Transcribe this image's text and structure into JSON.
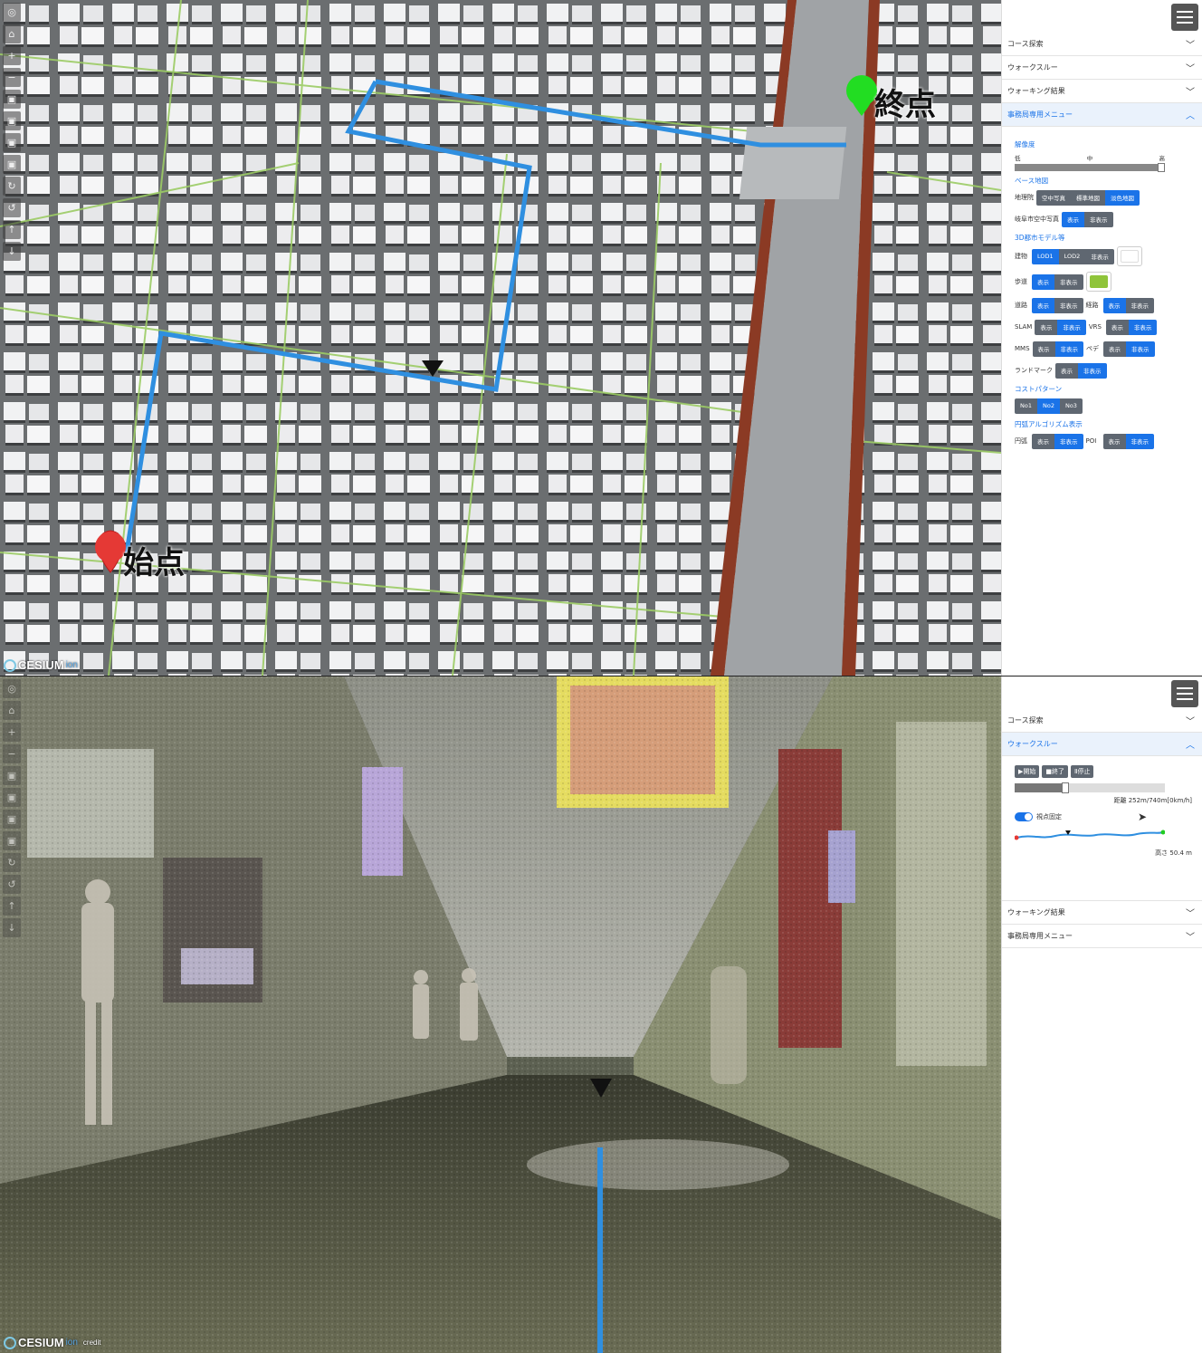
{
  "top_panel": {
    "start_label": "始点",
    "end_label": "終点",
    "logo": {
      "name": "CESIUM",
      "sub": "ion"
    },
    "toolbar_icons": [
      "compass-icon",
      "home-icon",
      "zoom-in-icon",
      "zoom-out-icon",
      "layer-icon",
      "layer-icon",
      "layer-icon",
      "layer-icon",
      "rotate-icon",
      "rotate-icon",
      "tilt-up-icon",
      "tilt-down-icon"
    ],
    "toolbar_glyphs": [
      "◎",
      "⌂",
      "+",
      "−",
      "▣",
      "▣",
      "▣",
      "▣",
      "↻",
      "↺",
      "↑",
      "↓"
    ],
    "side": {
      "accordion": [
        {
          "label": "コース探索",
          "open": false
        },
        {
          "label": "ウォークスルー",
          "open": false
        },
        {
          "label": "ウォーキング結果",
          "open": false
        },
        {
          "label": "事務局専用メニュー",
          "open": true
        }
      ],
      "resolution": {
        "title": "解像度",
        "low": "低",
        "mid": "中",
        "high": "高"
      },
      "base_map": {
        "title": "ベース地図",
        "gsi_label": "地理院",
        "gsi_options": [
          "空中写真",
          "標準地図",
          "淡色地図"
        ],
        "gsi_selected": 2,
        "gifu_label": "岐阜市空中写真",
        "gifu_options": [
          "表示",
          "非表示"
        ],
        "gifu_selected": 0
      },
      "city_model": {
        "title": "3D都市モデル等",
        "building_label": "建物",
        "building_options": [
          "LOD1",
          "LOD2",
          "非表示"
        ],
        "building_selected": 0,
        "building_color": "#ffffff",
        "walkway_label": "歩道",
        "walkway_options": [
          "表示",
          "非表示"
        ],
        "walkway_selected": 0,
        "walkway_color": "#8fc43a",
        "road_label": "道路",
        "road_options": [
          "表示",
          "非表示"
        ],
        "road_selected": 0,
        "route_label": "経路",
        "route_options": [
          "表示",
          "非表示"
        ],
        "route_selected": 0,
        "slam_label": "SLAM",
        "slam_options": [
          "表示",
          "非表示"
        ],
        "slam_selected": 1,
        "vrs_label": "VRS",
        "vrs_options": [
          "表示",
          "非表示"
        ],
        "vrs_selected": 1,
        "mms_label": "MMS",
        "mms_options": [
          "表示",
          "非表示"
        ],
        "mms_selected": 1,
        "pede_label": "ペデ",
        "pede_options": [
          "表示",
          "非表示"
        ],
        "pede_selected": 1,
        "landmark_label": "ランドマーク",
        "landmark_options": [
          "表示",
          "非表示"
        ],
        "landmark_selected": 1
      },
      "cost_pattern": {
        "title": "コストパターン",
        "options": [
          "No1",
          "No2",
          "No3"
        ],
        "selected": 1
      },
      "arc_algo": {
        "title": "円弧アルゴリズム表示",
        "arc_label": "円弧",
        "arc_options": [
          "表示",
          "非表示"
        ],
        "arc_selected": 1,
        "poi_label": "POI",
        "poi_options": [
          "表示",
          "非表示"
        ],
        "poi_selected": 1
      }
    }
  },
  "bottom_panel": {
    "logo": {
      "name": "CESIUM",
      "sub": "ion",
      "credit": "credit"
    },
    "side": {
      "accordion_top": [
        {
          "label": "コース探索",
          "open": false
        },
        {
          "label": "ウォークスルー",
          "open": true
        }
      ],
      "accordion_bottom": [
        {
          "label": "ウォーキング結果",
          "open": false
        },
        {
          "label": "事務局専用メニュー",
          "open": false
        }
      ],
      "walk": {
        "start": "▶開始",
        "end": "■終了",
        "pause": "Ⅱ停止",
        "progress": 0.34,
        "distance": "距離 252m/740m[0km/h]",
        "fix_view": "視点固定",
        "fix_view_on": true,
        "elevation": "高さ 50.4 m"
      }
    }
  }
}
